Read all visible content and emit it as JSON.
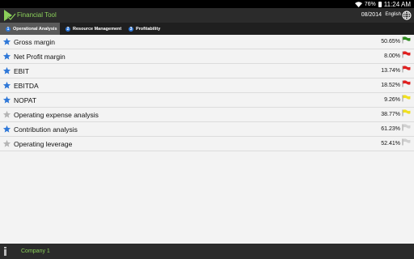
{
  "status_bar": {
    "battery": "76%",
    "time": "11:24 AM",
    "icons": [
      "wifi-icon",
      "battery-icon"
    ]
  },
  "app_bar": {
    "title": "Financial Tool",
    "period": "08/2014",
    "language": "English",
    "icons": [
      "app-logo-icon",
      "globe-icon"
    ]
  },
  "tabs": [
    {
      "number": "1",
      "label": "Operational Analysis",
      "active": true
    },
    {
      "number": "2",
      "label": "Resource Management",
      "active": false
    },
    {
      "number": "3",
      "label": "Profitability",
      "active": false
    }
  ],
  "colors": {
    "accent_green": "#8bd05a",
    "star_blue": "#2f78d8",
    "star_gray": "#b5b5b5",
    "flag_green": "#2e8b1e",
    "flag_red": "#e02020",
    "flag_yellow": "#f0e020",
    "flag_gray": "#d0d0d0"
  },
  "metrics": [
    {
      "label": "Gross margin",
      "value": "50.65%",
      "starred": true,
      "flag": "green"
    },
    {
      "label": "Net Profit margin",
      "value": "8.00%",
      "starred": true,
      "flag": "red"
    },
    {
      "label": "EBIT",
      "value": "13.74%",
      "starred": true,
      "flag": "red"
    },
    {
      "label": "EBITDA",
      "value": "18.52%",
      "starred": true,
      "flag": "red"
    },
    {
      "label": "NOPAT",
      "value": "9.26%",
      "starred": true,
      "flag": "yellow"
    },
    {
      "label": "Operating expense analysis",
      "value": "38.77%",
      "starred": false,
      "flag": "yellow"
    },
    {
      "label": "Contribution analysis",
      "value": "61.23%",
      "starred": true,
      "flag": "gray"
    },
    {
      "label": "Operating leverage",
      "value": "52.41%",
      "starred": false,
      "flag": "gray"
    }
  ],
  "bottom_bar": {
    "company": "Company 1",
    "icons": [
      "info-icon"
    ]
  }
}
